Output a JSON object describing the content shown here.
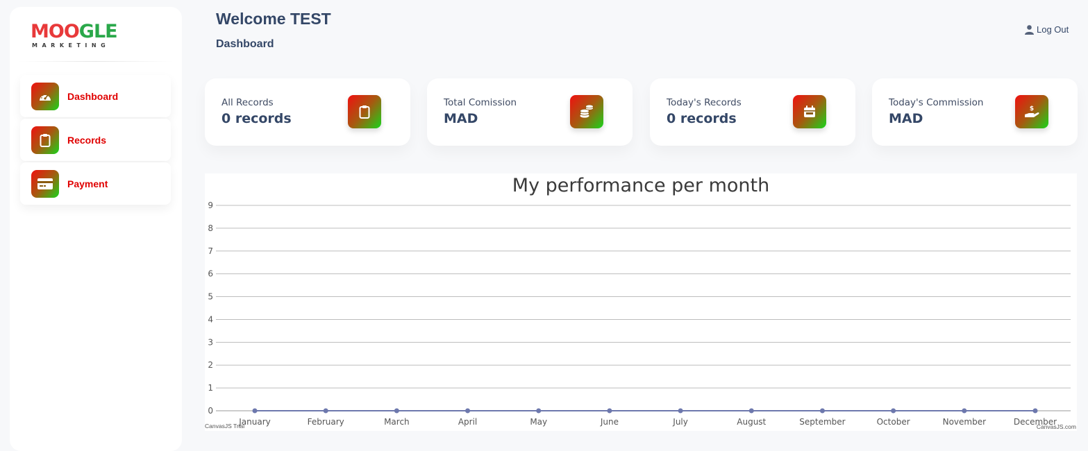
{
  "sidebar": {
    "logo": {
      "word_red": "MOO",
      "word_green": "GLE",
      "sub": "MARKETING"
    },
    "items": [
      {
        "label": "Dashboard",
        "icon": "speedometer-icon"
      },
      {
        "label": "Records",
        "icon": "clipboard-icon"
      },
      {
        "label": "Payment",
        "icon": "credit-card-icon"
      }
    ]
  },
  "header": {
    "welcome": "Welcome TEST",
    "breadcrumb": "Dashboard",
    "logout": "Log Out"
  },
  "cards": [
    {
      "label": "All Records",
      "value": "0 records",
      "icon": "clipboard-icon"
    },
    {
      "label": "Total Comission",
      "value": "MAD",
      "icon": "coins-icon"
    },
    {
      "label": "Today's Records",
      "value": "0 records",
      "icon": "calendar-icon"
    },
    {
      "label": "Today's Commission",
      "value": "MAD",
      "icon": "hand-dollar-icon"
    }
  ],
  "colors": {
    "accent_red": "#e00000",
    "gradient_start": "#f01010",
    "gradient_end": "#17d41a",
    "text_dark": "#344767",
    "series_line": "#6d78ad"
  },
  "chart_data": {
    "type": "line",
    "title": "My performance per month",
    "categories": [
      "January",
      "February",
      "March",
      "April",
      "May",
      "June",
      "July",
      "August",
      "September",
      "October",
      "November",
      "December"
    ],
    "values": [
      0,
      0,
      0,
      0,
      0,
      0,
      0,
      0,
      0,
      0,
      0,
      0
    ],
    "yticks": [
      0,
      1,
      2,
      3,
      4,
      5,
      6,
      7,
      8,
      9
    ],
    "ylim": [
      0,
      9
    ],
    "grid": true,
    "credit_left": "CanvasJS Trial",
    "credit_right": "CanvasJS.com"
  }
}
